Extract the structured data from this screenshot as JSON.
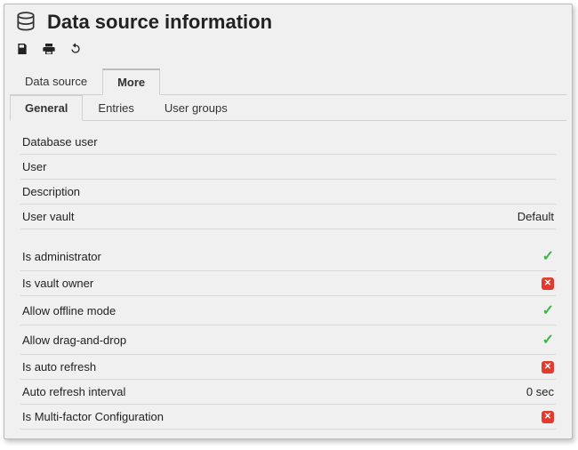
{
  "header": {
    "title": "Data source information"
  },
  "toolbar": {
    "save_label": "Save",
    "print_label": "Print",
    "refresh_label": "Refresh"
  },
  "tabs": {
    "primary": [
      {
        "label": "Data source",
        "active": false
      },
      {
        "label": "More",
        "active": true
      }
    ],
    "secondary": [
      {
        "label": "General",
        "active": true
      },
      {
        "label": "Entries",
        "active": false
      },
      {
        "label": "User groups",
        "active": false
      }
    ]
  },
  "properties_text": [
    {
      "label": "Database user",
      "value": ""
    },
    {
      "label": "User",
      "value": ""
    },
    {
      "label": "Description",
      "value": ""
    },
    {
      "label": "User vault",
      "value": "Default"
    }
  ],
  "properties_flags": [
    {
      "label": "Is administrator",
      "state": "yes"
    },
    {
      "label": "Is vault owner",
      "state": "no"
    },
    {
      "label": "Allow offline mode",
      "state": "yes"
    },
    {
      "label": "Allow drag-and-drop",
      "state": "yes"
    },
    {
      "label": "Is auto refresh",
      "state": "no"
    },
    {
      "label": "Auto refresh interval",
      "state": "text",
      "value": "0 sec"
    },
    {
      "label": "Is Multi-factor Configuration",
      "state": "no"
    }
  ]
}
